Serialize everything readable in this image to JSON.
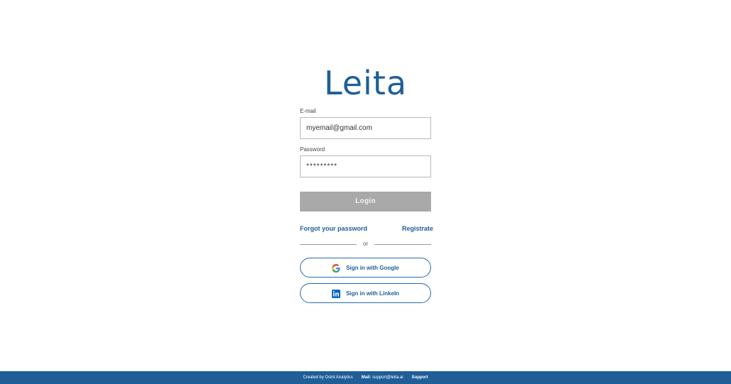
{
  "app": {
    "title": "Leita"
  },
  "form": {
    "email_label": "E-mail",
    "email_value": "myemail@gmail.com",
    "password_label": "Password",
    "password_value": "*********",
    "login_label": "Login",
    "forgot_label": "Forgot your password",
    "register_label": "Registrate",
    "divider_text": "or"
  },
  "social": {
    "google_label": "Sign in with Google",
    "google_icon": "google-icon",
    "linkedin_label": "Sign in with LinkeIn",
    "linkedin_icon": "linkedin-icon"
  },
  "footer": {
    "created_by": "Created by Osint Analytics",
    "mail_prefix": "Mail:",
    "mail_address": "support@leita.ai",
    "support_label": "Support"
  },
  "colors": {
    "brand": "#1f5e97",
    "button_disabled": "#a9a9a9",
    "input_border": "#b8b8b8"
  }
}
